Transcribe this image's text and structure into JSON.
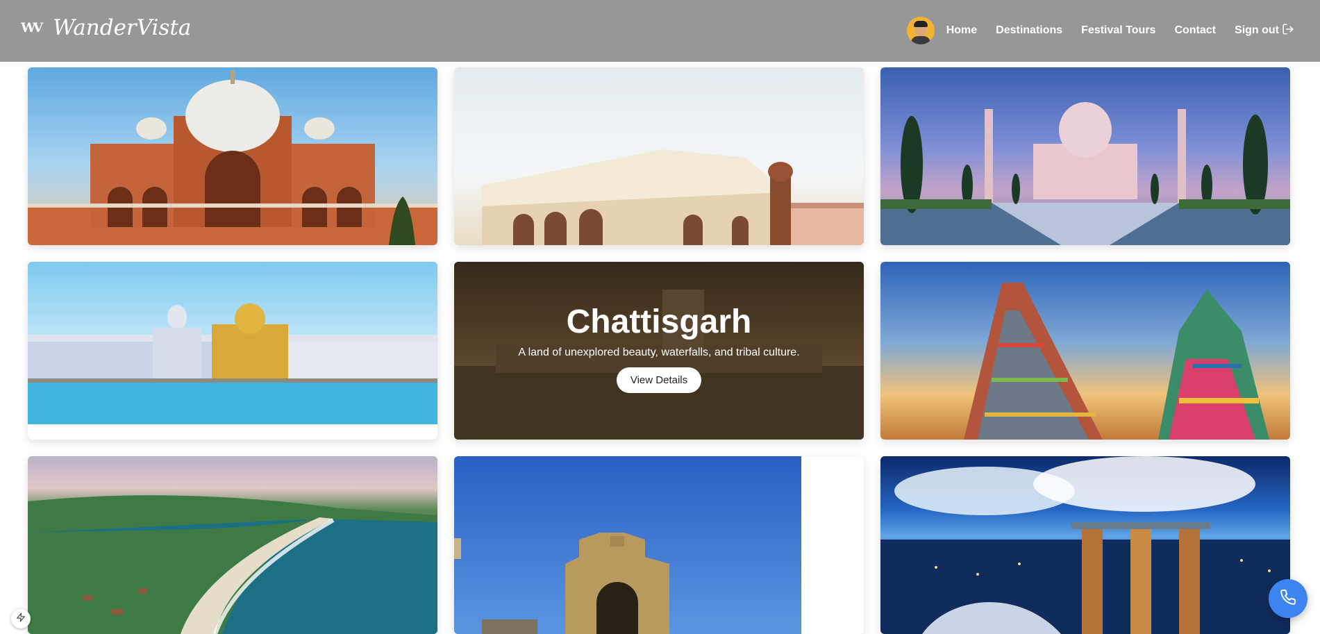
{
  "header": {
    "logo_mark": "WV",
    "logo_text": "WanderVista",
    "nav": [
      "Home",
      "Destinations",
      "Festival Tours",
      "Contact",
      "Sign out"
    ]
  },
  "cards": [
    {
      "scene": "humayun-tomb"
    },
    {
      "scene": "jaipur-palace"
    },
    {
      "scene": "taj-mahal"
    },
    {
      "scene": "golden-temple"
    },
    {
      "scene": "chhattisgarh",
      "title": "Chattisgarh",
      "description": "A land of unexplored beauty, waterfalls, and tribal culture.",
      "button": "View Details"
    },
    {
      "scene": "madurai-temple"
    },
    {
      "scene": "goa-beach"
    },
    {
      "scene": "gateway-of-india"
    },
    {
      "scene": "marina-bay-sands"
    }
  ],
  "colors": {
    "header_bg": "#979797",
    "call_button": "#3d84f0"
  }
}
